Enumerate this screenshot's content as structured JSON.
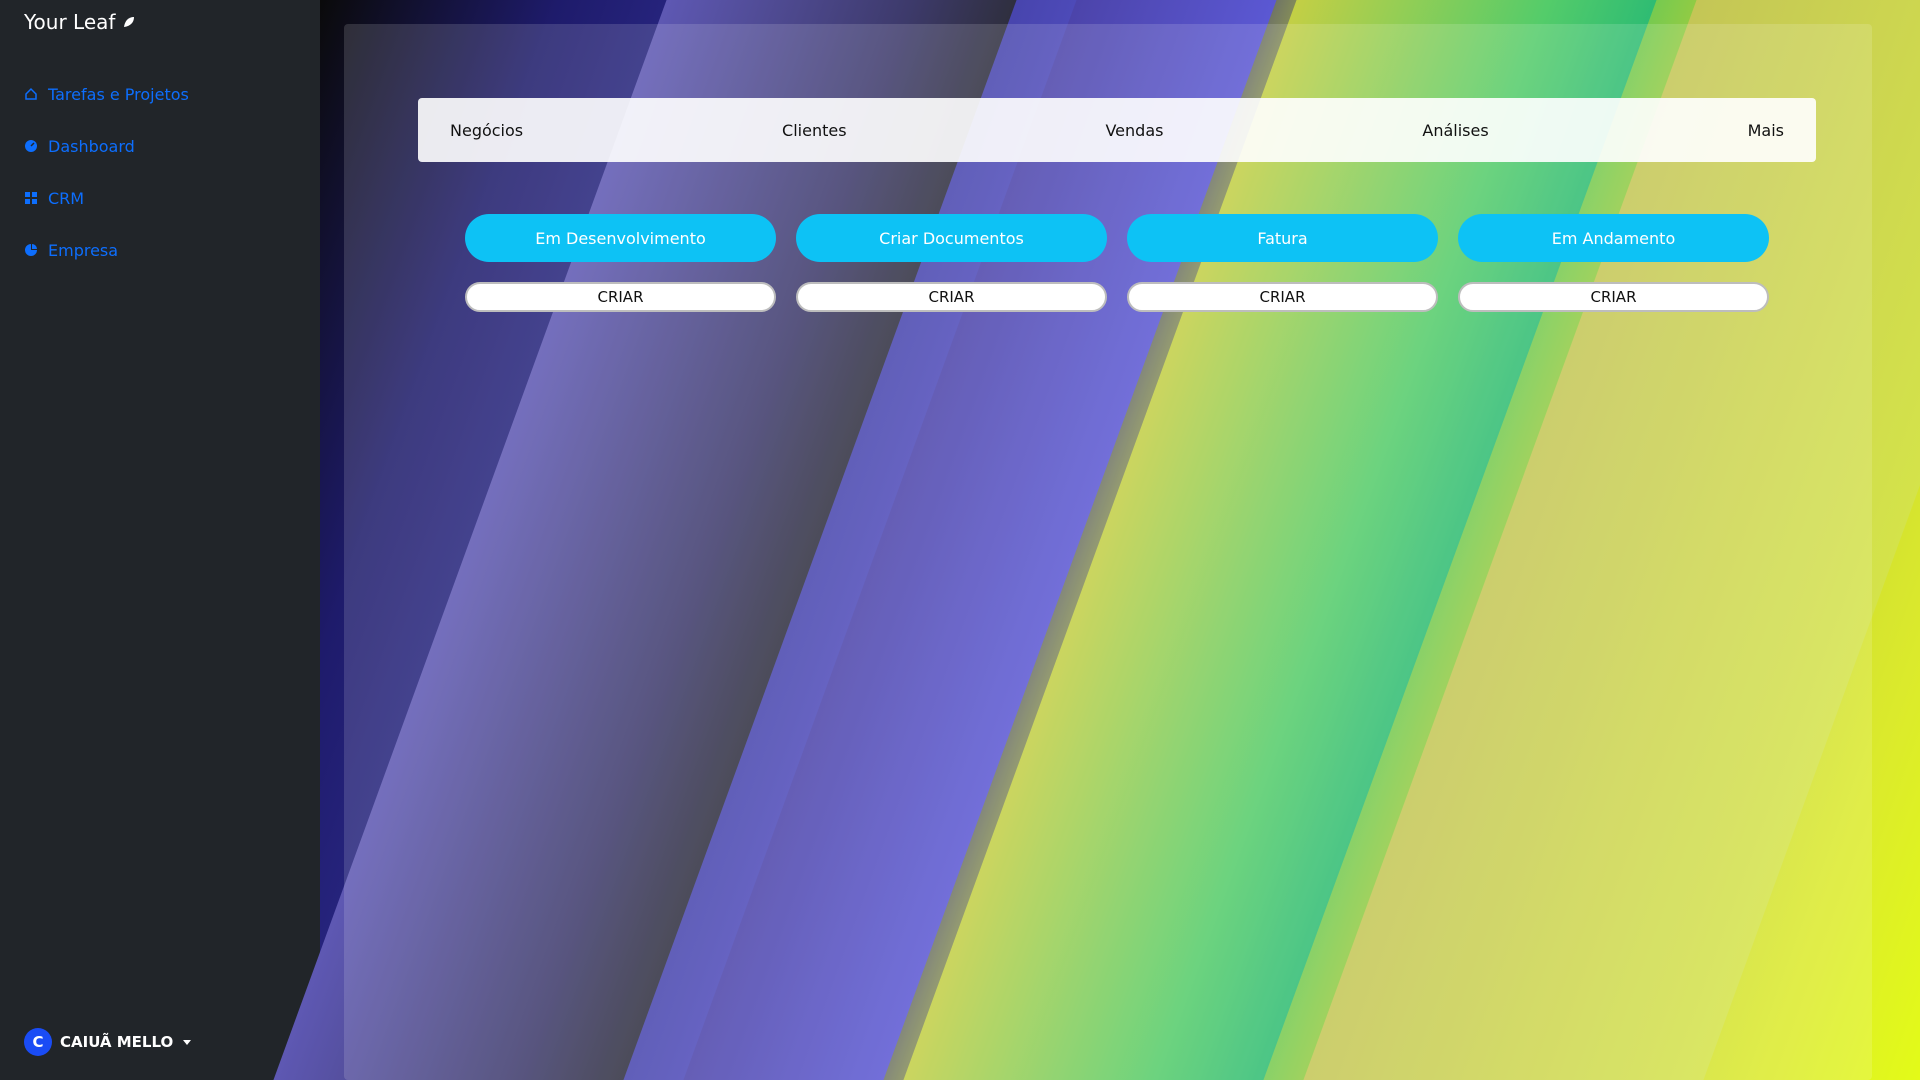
{
  "sidebar": {
    "brand": "Your Leaf",
    "nav": [
      {
        "label": "Tarefas e Projetos",
        "icon": "home-icon"
      },
      {
        "label": "Dashboard",
        "icon": "speedometer-icon"
      },
      {
        "label": "CRM",
        "icon": "grid-icon"
      },
      {
        "label": "Empresa",
        "icon": "pie-chart-icon"
      }
    ],
    "user": {
      "initial": "C",
      "name": "CAIUÃ MELLO"
    }
  },
  "tabs": [
    "Negócios",
    "Clientes",
    "Vendas",
    "Análises",
    "Mais"
  ],
  "cards": [
    {
      "title": "Em Desenvolvimento",
      "action": "CRIAR"
    },
    {
      "title": "Criar Documentos",
      "action": "CRIAR"
    },
    {
      "title": "Fatura",
      "action": "CRIAR"
    },
    {
      "title": "Em Andamento",
      "action": "CRIAR"
    }
  ],
  "colors": {
    "sidebar_bg": "#212529",
    "link": "#0d6efd",
    "pill": "#0dc2f5"
  }
}
